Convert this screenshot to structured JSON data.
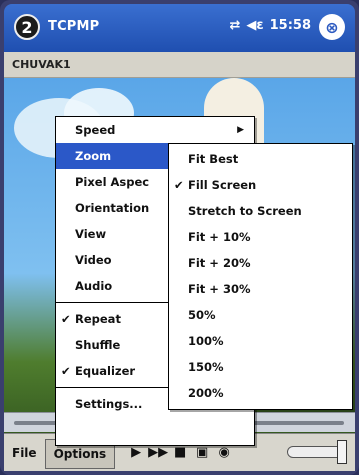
{
  "titlebar": {
    "badge": "2",
    "app_title": "TCPMP",
    "status_time": "15:58",
    "status_icons": [
      "connectivity-icon",
      "speaker-icon"
    ],
    "close_label": "⊗"
  },
  "file_title": "CHUVAK1",
  "options_menu": {
    "items": [
      {
        "label": "Speed",
        "submenu": true,
        "checked": false
      },
      {
        "label": "Zoom",
        "submenu": true,
        "checked": false,
        "selected": true
      },
      {
        "label": "Pixel Aspec",
        "submenu": true,
        "checked": false
      },
      {
        "label": "Orientation",
        "submenu": true,
        "checked": false
      },
      {
        "label": "View",
        "submenu": true,
        "checked": false
      },
      {
        "label": "Video",
        "submenu": true,
        "checked": false
      },
      {
        "label": "Audio",
        "submenu": true,
        "checked": false
      },
      {
        "label": "Repeat",
        "submenu": false,
        "checked": true
      },
      {
        "label": "Shuffle",
        "submenu": false,
        "checked": false
      },
      {
        "label": "Equalizer",
        "submenu": false,
        "checked": true
      },
      {
        "label": "Settings...",
        "submenu": false,
        "checked": false
      }
    ]
  },
  "zoom_menu": {
    "items": [
      {
        "label": "Fit Best",
        "checked": false
      },
      {
        "label": "Fill Screen",
        "checked": true
      },
      {
        "label": "Stretch to Screen",
        "checked": false
      },
      {
        "label": "Fit + 10%",
        "checked": false
      },
      {
        "label": "Fit + 20%",
        "checked": false
      },
      {
        "label": "Fit + 30%",
        "checked": false
      },
      {
        "label": "50%",
        "checked": false
      },
      {
        "label": "100%",
        "checked": false
      },
      {
        "label": "150%",
        "checked": false
      },
      {
        "label": "200%",
        "checked": false
      }
    ]
  },
  "toolbar": {
    "file_label": "File",
    "options_label": "Options",
    "controls": [
      "play-icon",
      "fast-forward-icon",
      "stop-icon",
      "fullscreen-icon",
      "volume-icon"
    ]
  },
  "colors": {
    "titlebar": "#2c5ac0",
    "menu_highlight": "#2b58c8"
  }
}
